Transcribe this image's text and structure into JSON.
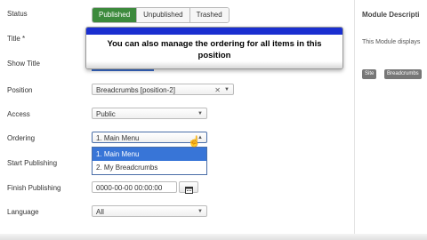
{
  "form": {
    "status_label": "Status",
    "status_options": [
      "Published",
      "Unpublished",
      "Trashed"
    ],
    "title_label": "Title *",
    "show_title_label": "Show Title",
    "position_label": "Position",
    "position_value": "Breadcrumbs [position-2]",
    "access_label": "Access",
    "access_value": "Public",
    "ordering_label": "Ordering",
    "ordering_value": "1. Main Menu",
    "ordering_options": [
      "1. Main Menu",
      "2. My Breadcrumbs"
    ],
    "start_publishing_label": "Start Publishing",
    "finish_publishing_label": "Finish Publishing",
    "finish_publishing_value": "0000-00-00 00:00:00",
    "language_label": "Language",
    "language_value": "All"
  },
  "sidebar": {
    "title": "Module Descripti",
    "description": "This Module displays",
    "tags": [
      "Site",
      "Breadcrumbs"
    ]
  },
  "overlay": {
    "text": "You can also manage the ordering for all items in this position"
  }
}
